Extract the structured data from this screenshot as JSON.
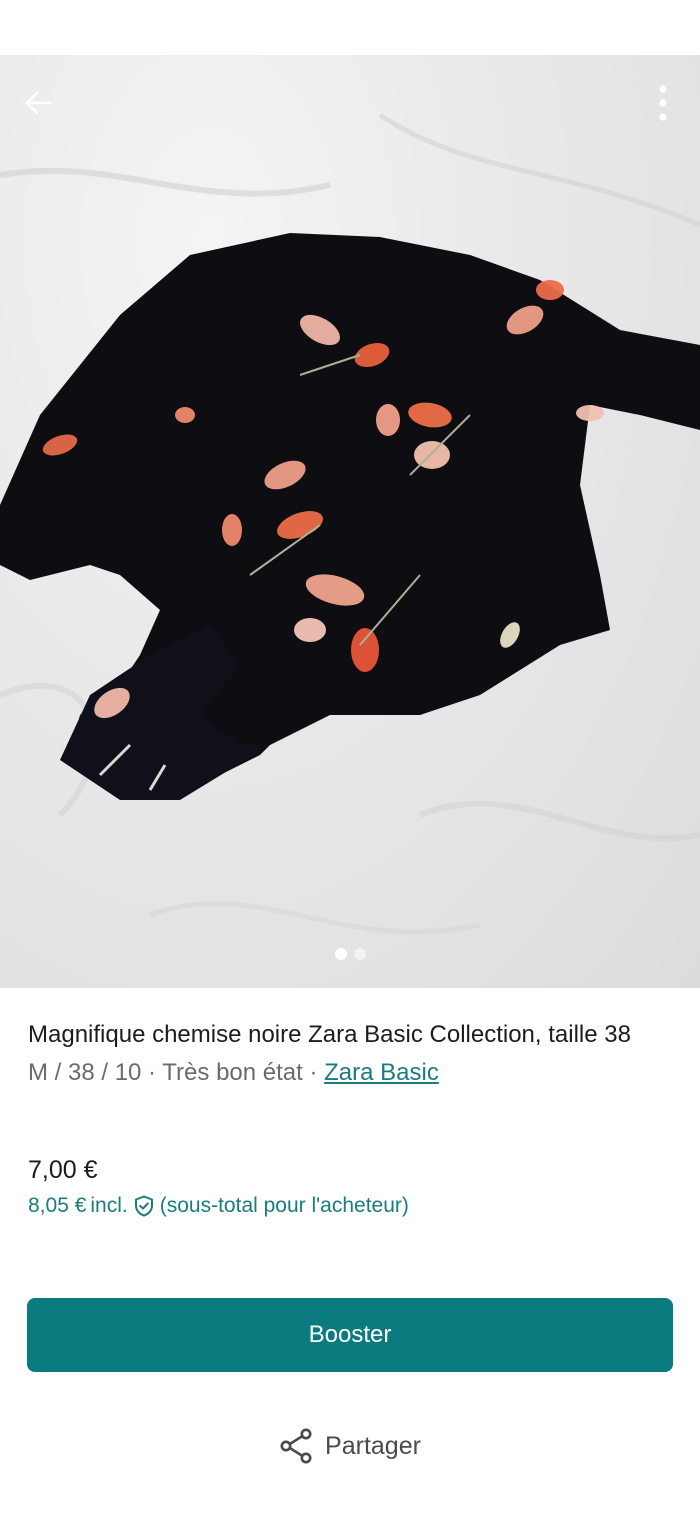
{
  "header": {
    "back_icon": "arrow-left-icon",
    "menu_icon": "more-vertical-icon"
  },
  "gallery": {
    "image_count": 2,
    "active_index": 0
  },
  "item": {
    "title": "Magnifique chemise noire Zara Basic Collection, taille 38",
    "meta_text": "M / 38 / 10 · Très bon état · ",
    "brand": "Zara Basic",
    "price": "7,00 €",
    "price_incl_amount": "8,05 €",
    "price_incl_label": "incl.",
    "price_incl_note": "(sous-total pour l'acheteur)",
    "protection_icon": "shield-check-icon"
  },
  "actions": {
    "booster_label": "Booster",
    "share_label": "Partager",
    "share_icon": "share-icon"
  },
  "colors": {
    "accent": "#0b7b80",
    "link": "#1a7b80"
  }
}
